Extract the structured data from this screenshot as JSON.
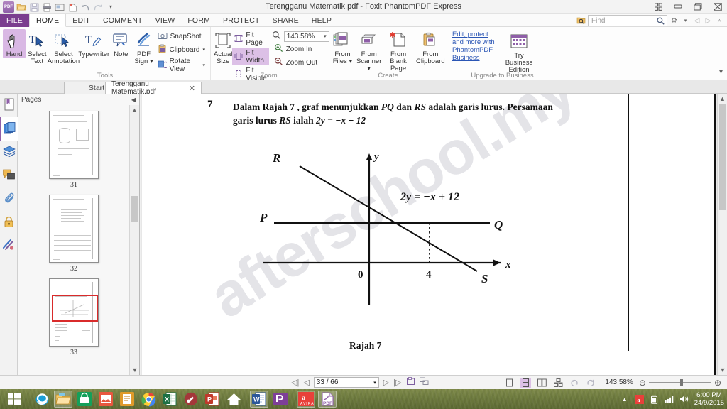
{
  "window": {
    "title": "Terengganu Matematik.pdf - Foxit PhantomPDF Express",
    "controls": {
      "restore": "❐",
      "minimize": "▭",
      "maximize": "❐",
      "close": "✕"
    }
  },
  "quick_access": [
    {
      "name": "pdf-logo-icon",
      "label": "PDF"
    },
    {
      "name": "open-icon",
      "label": "📂"
    },
    {
      "name": "save-icon",
      "label": "💾"
    },
    {
      "name": "print-icon",
      "label": "🖨"
    },
    {
      "name": "snapshot-icon",
      "label": "▣"
    },
    {
      "name": "stamp-icon",
      "label": "❦"
    },
    {
      "name": "undo-icon",
      "label": "↺"
    },
    {
      "name": "redo-icon",
      "label": "↻"
    },
    {
      "name": "qat-dropdown-icon",
      "label": "▾"
    }
  ],
  "menu": {
    "items": [
      {
        "label": "FILE",
        "id": "file"
      },
      {
        "label": "HOME",
        "id": "home"
      },
      {
        "label": "EDIT",
        "id": "edit"
      },
      {
        "label": "COMMENT",
        "id": "comment"
      },
      {
        "label": "VIEW",
        "id": "view"
      },
      {
        "label": "FORM",
        "id": "form"
      },
      {
        "label": "PROTECT",
        "id": "protect"
      },
      {
        "label": "SHARE",
        "id": "share"
      },
      {
        "label": "HELP",
        "id": "help"
      }
    ],
    "active": "HOME"
  },
  "find": {
    "placeholder": "Find",
    "value": "",
    "search_icon": "🔍",
    "settings_icon": "⚙",
    "prev_icon": "◁",
    "next_icon": "▷",
    "collapse_icon": "△"
  },
  "ribbon": {
    "groups": [
      {
        "name": "Tools",
        "buttons": [
          {
            "label": "Hand",
            "selected": true
          },
          {
            "label": "Select\nText",
            "selected": false
          },
          {
            "label": "Select\nAnnotation",
            "selected": false
          },
          {
            "label": "Typewriter",
            "selected": false
          },
          {
            "label": "Note",
            "selected": false
          },
          {
            "label": "PDF\nSign",
            "selected": false
          }
        ],
        "small_buttons": [
          {
            "label": "SnapShot"
          },
          {
            "label": "Clipboard"
          },
          {
            "label": "Rotate View"
          }
        ]
      },
      {
        "name": "Zoom",
        "big": {
          "label": "Actual\nSize"
        },
        "small_buttons": [
          {
            "label": "Fit Page",
            "selected": false
          },
          {
            "label": "Fit Width",
            "selected": true
          },
          {
            "label": "Fit Visible",
            "selected": false
          },
          {
            "label": "Zoom In",
            "selected": false
          },
          {
            "label": "Zoom Out",
            "selected": false
          }
        ],
        "zoom_value": "143.58%"
      },
      {
        "name": "Create",
        "buttons": [
          {
            "label": "From\nFiles"
          },
          {
            "label": "From\nScanner"
          },
          {
            "label": "From\nBlank Page"
          },
          {
            "label": "From\nClipboard"
          }
        ]
      },
      {
        "name": "Upgrade to Business",
        "link_text": "Edit, protect and more with PhantomPDF Business",
        "button_label": "Try Business\nEdition"
      }
    ],
    "collapse_icon": "▾"
  },
  "doc_tabs": {
    "tabs": [
      {
        "label": "Start",
        "active": false,
        "closable": false
      },
      {
        "label": "Terengganu Matematik.pdf",
        "active": true,
        "closable": true
      }
    ],
    "close_icon": "✕"
  },
  "sidebar": {
    "rail_items": [
      {
        "name": "bookmarks-icon",
        "selected": false
      },
      {
        "name": "pages-icon",
        "selected": true
      },
      {
        "name": "layers-icon",
        "selected": false
      },
      {
        "name": "comments-icon",
        "selected": false
      },
      {
        "name": "attachments-icon",
        "selected": false
      },
      {
        "name": "security-lock-icon",
        "selected": false
      },
      {
        "name": "digital-signature-icon",
        "selected": false
      }
    ],
    "panel_title": "Pages",
    "collapse_icon": "◀",
    "thumbnails": [
      {
        "number": "31",
        "selected": false
      },
      {
        "number": "32",
        "selected": false
      },
      {
        "number": "33",
        "selected": true
      }
    ]
  },
  "document": {
    "question_number": "7",
    "question_line1_a": "Dalam Rajah 7",
    "question_line1_b": ", graf menunjukkan",
    "question_pq": "PQ",
    "question_dan": "dan",
    "question_rs": "RS",
    "question_line1_c": "adalah garis lurus. Persamaan",
    "question_line2_a": "garis lurus",
    "question_rs2": "RS",
    "question_line2_b": "ialah",
    "question_equation": "2y = −x + 12",
    "figure_caption": "Rajah 7",
    "watermark": "afterschool.my",
    "chart_data": {
      "type": "line",
      "title": "Rajah 7",
      "xlabel": "x",
      "ylabel": "y",
      "annotations": [
        "2y = −x + 12"
      ],
      "tick_labels": {
        "x": [
          "0",
          "4"
        ],
        "y": []
      },
      "grid": false,
      "series": [
        {
          "name": "PQ",
          "label_start": "P",
          "label_end": "Q",
          "type": "horizontal-line",
          "y": 4,
          "points": [
            [
              -7.5,
              4
            ],
            [
              8.5,
              4
            ]
          ]
        },
        {
          "name": "RS",
          "label_start": "R",
          "label_end": "S",
          "equation": "2y = -x + 12",
          "points": [
            [
              -3.2,
              7.6
            ],
            [
              7.8,
              2.1
            ]
          ]
        }
      ],
      "dashed_guides": [
        {
          "from": [
            4,
            0
          ],
          "to": [
            4,
            4
          ],
          "style": "dotted"
        }
      ],
      "axes": {
        "x_axis": true,
        "y_axis": true,
        "origin_label": "0"
      }
    }
  },
  "statusbar": {
    "first_page_icon": "◁|",
    "prev_page_icon": "◁",
    "page_value": "33 / 66",
    "page_dropdown_icon": "▾",
    "next_page_icon": "▷",
    "last_page_icon": "|▷",
    "extra_icons": [
      "fit-page-icon",
      "split-view-icon"
    ],
    "view_modes": [
      {
        "name": "single-page-icon",
        "selected": false
      },
      {
        "name": "continuous-icon",
        "selected": true
      },
      {
        "name": "facing-icon",
        "selected": false
      },
      {
        "name": "separate-cover-icon",
        "selected": false
      },
      {
        "name": "rotate-left-icon",
        "selected": false
      },
      {
        "name": "rotate-right-icon",
        "selected": false
      }
    ],
    "zoom_value": "143.58%",
    "zoom_out_icon": "⊖",
    "zoom_in_icon": "⊕"
  },
  "taskbar": {
    "start_icon": "windows-logo-icon",
    "apps": [
      {
        "name": "internet-explorer-icon",
        "open": false
      },
      {
        "name": "file-explorer-icon",
        "open": true
      },
      {
        "name": "store-icon",
        "open": false
      },
      {
        "name": "photos-icon",
        "open": false
      },
      {
        "name": "reader-icon",
        "open": false
      },
      {
        "name": "google-chrome-icon",
        "open": false
      },
      {
        "name": "excel-icon",
        "open": false
      },
      {
        "name": "access-icon",
        "open": false
      },
      {
        "name": "powerpoint-icon",
        "open": false
      },
      {
        "name": "home-icon",
        "open": false
      },
      {
        "name": "word-icon",
        "open": true
      },
      {
        "name": "publisher-icon",
        "open": false
      },
      {
        "name": "avira-icon",
        "open": true
      },
      {
        "name": "foxit-pdf-icon",
        "open": true
      }
    ],
    "tray": {
      "show_hidden_icon": "▴",
      "avira-tray-icon": "A",
      "battery_icon": "▮",
      "network_icon": "📶",
      "volume_icon": "🔊",
      "time": "6:00 PM",
      "date": "24/9/2015"
    }
  }
}
